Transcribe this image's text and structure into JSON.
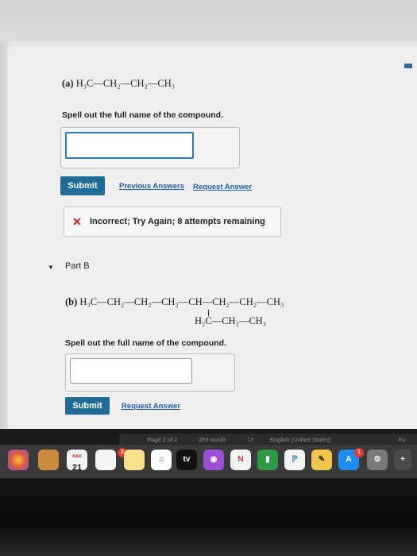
{
  "part_a": {
    "label": "(a)",
    "formula": "H₃C—CH₂—CH₂—CH₃",
    "prompt": "Spell out the full name of the compound.",
    "input_value": "",
    "submit_label": "Submit",
    "previous_answers_label": "Previous Answers",
    "request_answer_label": "Request Answer",
    "feedback": "Incorrect; Try Again; 8 attempts remaining"
  },
  "part_b": {
    "title": "Part B",
    "label": "(b)",
    "formula_main": "H₃C—CH₂—CH₂—CH₂—CH—CH₂—CH₂—CH₃",
    "formula_branch": "H₂C—CH₂—CH₃",
    "prompt": "Spell out the full name of the compound.",
    "input_value": "",
    "submit_label": "Submit",
    "request_answer_label": "Request Answer"
  },
  "status_bar": {
    "page": "Page 2 of 2",
    "words": "359 words",
    "language": "English (United States)",
    "right_label": "Fo"
  },
  "dock": {
    "calendar_day": "21",
    "calendar_month": "MAR",
    "tv_label": "tv",
    "badge_notes": "2",
    "badge_appstore": "1"
  },
  "colors": {
    "submit": "#1f6d96",
    "link": "#1f5fa8",
    "error": "#d02020",
    "focus_border": "#2f78b7"
  }
}
